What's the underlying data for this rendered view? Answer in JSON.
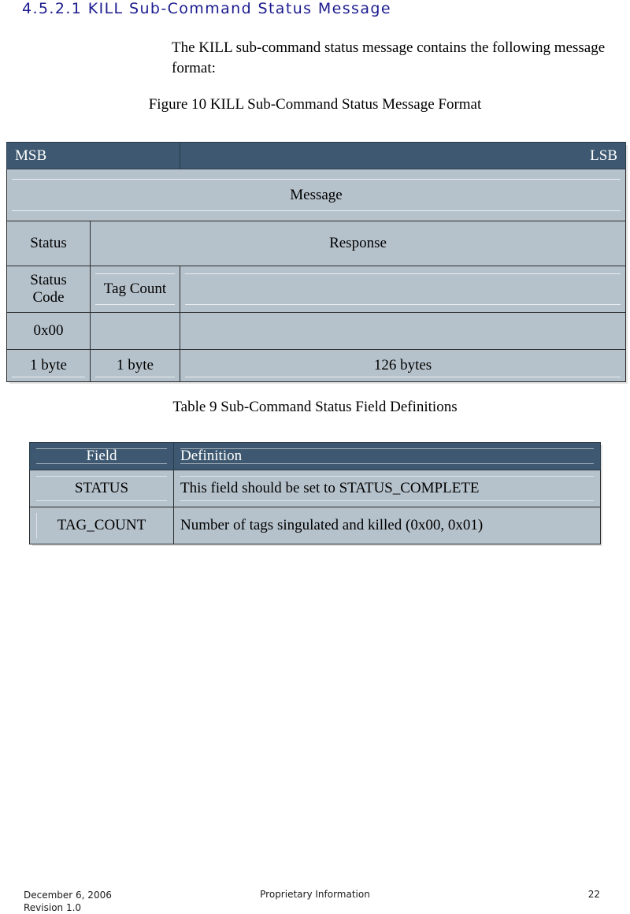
{
  "heading": "4.5.2.1 KILL Sub-Command Status Message",
  "body_paragraph": "The KILL sub-command status message contains the following message format:",
  "figure_caption": "Figure 10 KILL Sub-Command Status Message Format",
  "table_caption": "Table 9 Sub-Command Status Field Definitions",
  "colors": {
    "heading": "#1b1b8f",
    "table_header_bg": "#3d5870",
    "table_cell_bg": "#b6c2cb",
    "table_border": "#2b2b2b",
    "header_text": "#ffffff"
  },
  "figure_table": {
    "header": {
      "msb": "MSB",
      "lsb": "LSB"
    },
    "rows": [
      {
        "message": "Message"
      },
      {
        "col1": "Status",
        "col2": "Response"
      },
      {
        "col1": "Status Code",
        "col1_line1": "Status",
        "col1_line2": "Code",
        "col2": "Tag Count",
        "col3": ""
      },
      {
        "col1": "0x00",
        "col2": "",
        "col3": ""
      },
      {
        "col1": "1 byte",
        "col2": "1 byte",
        "col3": "126 bytes"
      }
    ]
  },
  "definitions_table": {
    "columns": [
      "Field",
      "Definition"
    ],
    "rows": [
      {
        "field": "STATUS",
        "definition": "This field should be set to STATUS_COMPLETE"
      },
      {
        "field": "TAG_COUNT",
        "definition": "Number of tags singulated and killed (0x00, 0x01)"
      }
    ]
  },
  "footer": {
    "date": "December 6, 2006",
    "revision": "Revision 1.0",
    "center": "Proprietary Information",
    "page_number": "22"
  }
}
